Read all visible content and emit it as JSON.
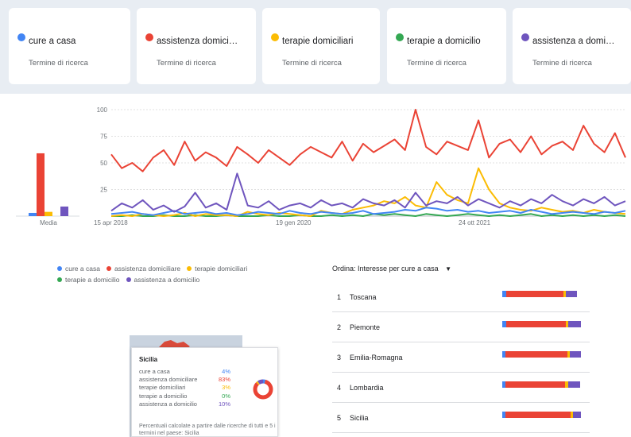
{
  "colors": {
    "cure_a_casa": "#4285f4",
    "assistenza_domiciliare": "#ea4335",
    "terapie_domiciliari": "#fbbc04",
    "terapie_a_domicilio": "#34a853",
    "assistenza_a_domicilio": "#6f55be",
    "grid": "#e0e0e0",
    "axis_label": "#70757a"
  },
  "terms": [
    {
      "label": "cure a casa",
      "sub": "Termine di ricerca",
      "color": "#4285f4"
    },
    {
      "label": "assistenza domici…",
      "sub": "Termine di ricerca",
      "color": "#ea4335"
    },
    {
      "label": "terapie domiciliari",
      "sub": "Termine di ricerca",
      "color": "#fbbc04"
    },
    {
      "label": "terapie a domicilio",
      "sub": "Termine di ricerca",
      "color": "#34a853"
    },
    {
      "label": "assistenza a domi…",
      "sub": "Termine di ricerca",
      "color": "#6f55be"
    }
  ],
  "legend": [
    {
      "label": "cure a casa",
      "color": "#4285f4"
    },
    {
      "label": "assistenza domiciliare",
      "color": "#ea4335"
    },
    {
      "label": "terapie domiciliari",
      "color": "#fbbc04"
    },
    {
      "label": "terapie a domicilio",
      "color": "#34a853"
    },
    {
      "label": "assistenza a domicilio",
      "color": "#6f55be"
    }
  ],
  "chart_data": [
    {
      "type": "bar",
      "title": "",
      "xlabel": "Media",
      "categories": [
        "cure a casa",
        "assistenza domiciliare",
        "terapie domiciliari",
        "terapie a domicilio",
        "assistenza a domicilio"
      ],
      "values": [
        3,
        59,
        4,
        0,
        9
      ],
      "colors": [
        "#4285f4",
        "#ea4335",
        "#fbbc04",
        "#34a853",
        "#6f55be"
      ],
      "ylim": [
        0,
        100
      ]
    },
    {
      "type": "line",
      "title": "",
      "x_tick_labels": [
        "15 apr 2018",
        "19 gen 2020",
        "24 ott 2021"
      ],
      "y_ticks": [
        25,
        50,
        75,
        100
      ],
      "ylim": [
        0,
        100
      ],
      "grid": true,
      "series": [
        {
          "name": "cure a casa",
          "color": "#4285f4",
          "values": [
            2,
            3,
            4,
            2,
            1,
            3,
            5,
            2,
            3,
            4,
            2,
            3,
            1,
            2,
            4,
            3,
            2,
            5,
            3,
            2,
            4,
            3,
            2,
            3,
            5,
            2,
            3,
            4,
            6,
            5,
            8,
            7,
            5,
            6,
            4,
            5,
            3,
            4,
            5,
            3,
            6,
            4,
            2,
            3,
            4,
            3,
            2,
            4,
            3,
            5
          ]
        },
        {
          "name": "assistenza domiciliare",
          "color": "#ea4335",
          "values": [
            58,
            45,
            50,
            42,
            55,
            62,
            48,
            70,
            52,
            60,
            55,
            47,
            65,
            58,
            50,
            62,
            55,
            48,
            58,
            65,
            60,
            55,
            70,
            52,
            68,
            60,
            66,
            72,
            62,
            100,
            65,
            58,
            70,
            66,
            62,
            90,
            55,
            68,
            72,
            60,
            75,
            58,
            66,
            70,
            62,
            85,
            68,
            60,
            78,
            55
          ]
        },
        {
          "name": "terapie domiciliari",
          "color": "#fbbc04",
          "values": [
            0,
            1,
            0,
            2,
            1,
            0,
            1,
            3,
            0,
            2,
            1,
            1,
            0,
            4,
            2,
            1,
            3,
            2,
            1,
            0,
            5,
            3,
            2,
            6,
            8,
            10,
            14,
            12,
            18,
            10,
            8,
            32,
            20,
            15,
            12,
            45,
            25,
            12,
            8,
            6,
            5,
            8,
            6,
            4,
            5,
            3,
            6,
            4,
            3,
            2
          ]
        },
        {
          "name": "terapie a domicilio",
          "color": "#34a853",
          "values": [
            0,
            0,
            1,
            0,
            0,
            1,
            0,
            0,
            1,
            0,
            0,
            1,
            0,
            0,
            0,
            1,
            0,
            0,
            1,
            0,
            0,
            1,
            0,
            1,
            0,
            2,
            1,
            2,
            1,
            0,
            2,
            1,
            0,
            1,
            2,
            1,
            0,
            1,
            0,
            1,
            2,
            0,
            1,
            0,
            1,
            0,
            1,
            0,
            1,
            0
          ]
        },
        {
          "name": "assistenza a domicilio",
          "color": "#6f55be",
          "values": [
            5,
            12,
            8,
            15,
            6,
            10,
            4,
            9,
            22,
            8,
            12,
            6,
            40,
            10,
            8,
            14,
            6,
            10,
            12,
            8,
            15,
            10,
            12,
            8,
            16,
            12,
            10,
            15,
            8,
            22,
            10,
            14,
            12,
            18,
            10,
            16,
            12,
            8,
            14,
            10,
            16,
            12,
            20,
            14,
            10,
            16,
            12,
            18,
            10,
            14
          ]
        }
      ]
    }
  ],
  "tooltip": {
    "region": "Sicilia",
    "rows": [
      {
        "label": "cure a casa",
        "value": "4%",
        "color": "#4285f4"
      },
      {
        "label": "assistenza domiciliare",
        "value": "83%",
        "color": "#ea4335"
      },
      {
        "label": "terapie domiciliari",
        "value": "3%",
        "color": "#fbbc04"
      },
      {
        "label": "terapie a domicilio",
        "value": "0%",
        "color": "#34a853"
      },
      {
        "label": "assistenza a domicilio",
        "value": "10%",
        "color": "#6f55be"
      }
    ],
    "shares": [
      4,
      83,
      3,
      0,
      10
    ],
    "note": "Percentuali calcolate a partire dalle ricerche di tutti e 5 i termini nel paese: Sicilia"
  },
  "sort": {
    "label": "Ordina:",
    "value": "Interesse per cure a casa"
  },
  "regions": [
    {
      "rank": "1",
      "name": "Toscana",
      "shares": [
        5,
        73,
        3,
        0,
        14
      ]
    },
    {
      "rank": "2",
      "name": "Piemonte",
      "shares": [
        5,
        76,
        3,
        0,
        16
      ]
    },
    {
      "rank": "3",
      "name": "Emilia-Romagna",
      "shares": [
        4,
        79,
        3,
        0,
        14
      ]
    },
    {
      "rank": "4",
      "name": "Lombardia",
      "shares": [
        4,
        76,
        4,
        0,
        15
      ]
    },
    {
      "rank": "5",
      "name": "Sicilia",
      "shares": [
        4,
        83,
        3,
        0,
        10
      ]
    }
  ]
}
